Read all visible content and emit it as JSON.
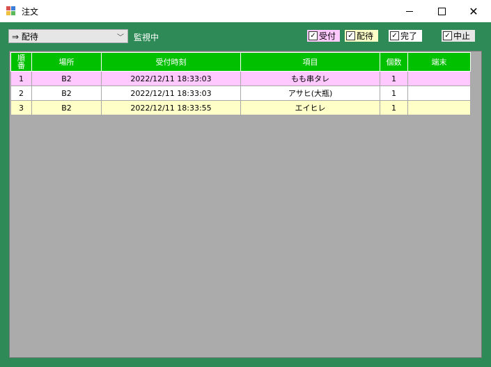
{
  "window": {
    "title": "注文"
  },
  "toolbar": {
    "combo_value": "⇒ 配待",
    "status": "監視中",
    "checkboxes": [
      {
        "label": "受付",
        "checked": true,
        "color": "#ffc8ff"
      },
      {
        "label": "配待",
        "checked": true,
        "color": "#ffffc8"
      },
      {
        "label": "完了",
        "checked": true,
        "color": "#ffffff"
      },
      {
        "label": "中止",
        "checked": true,
        "color": "#e6e6e6"
      }
    ]
  },
  "table": {
    "header_color": "#00c000",
    "columns": [
      "順番",
      "場所",
      "受付時刻",
      "項目",
      "個数",
      "端末"
    ],
    "rows": [
      {
        "no": "1",
        "place": "B2",
        "time": "2022/12/11 18:33:03",
        "item": "もも串タレ",
        "qty": "1",
        "terminal": ""
      },
      {
        "no": "2",
        "place": "B2",
        "time": "2022/12/11 18:33:03",
        "item": "アサヒ(大瓶)",
        "qty": "1",
        "terminal": ""
      },
      {
        "no": "3",
        "place": "B2",
        "time": "2022/12/11 18:33:55",
        "item": "エイヒレ",
        "qty": "1",
        "terminal": ""
      }
    ]
  },
  "colors": {
    "background": "#2e8b57",
    "grid_empty": "#ababab"
  }
}
